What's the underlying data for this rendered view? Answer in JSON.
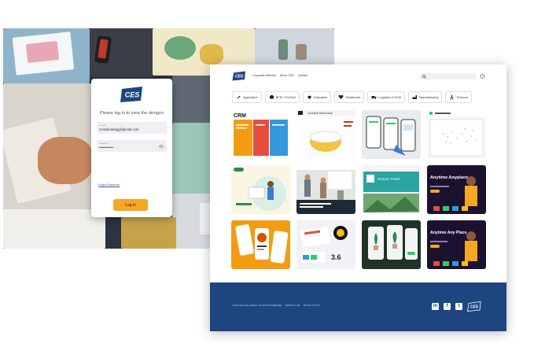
{
  "login": {
    "logo_text": "CES",
    "prompt": "Please log in to view the designs",
    "email_label": "E-mail",
    "email_value": "Cristiandebgg@gmail.com",
    "password_label": "Password",
    "password_value": "••••••••••••",
    "forgot_link": "Forgot Password",
    "login_button": "Log in"
  },
  "portfolio": {
    "logo_text": "CES",
    "nav": [
      "Corporate Website",
      "About CES",
      "Contact"
    ],
    "categories": [
      {
        "label": "Agriculture",
        "icon": "agriculture-icon"
      },
      {
        "label": "BFSI / FinTech",
        "icon": "fintech-icon"
      },
      {
        "label": "Education",
        "icon": "graduation-cap-icon"
      },
      {
        "label": "Healthcare",
        "icon": "heart-icon"
      },
      {
        "label": "Logistics & SCM",
        "icon": "truck-icon"
      },
      {
        "label": "Manufacturing",
        "icon": "factory-icon"
      },
      {
        "label": "Telecom",
        "icon": "tower-icon"
      }
    ],
    "thumbnails": [
      {
        "title": "CRM",
        "caption": "Cohort table app design"
      },
      {
        "title": "Cerebral Teach Now",
        "caption": "Education app"
      },
      {
        "title": "",
        "caption": "Mobile app screens"
      },
      {
        "title": "",
        "caption": "Data dashboard"
      },
      {
        "title": "",
        "caption": "Healthcare web"
      },
      {
        "title": "",
        "caption": "Office team"
      },
      {
        "title": "Genetic Portal",
        "caption": "Genetics app"
      },
      {
        "title": "Anytime Anyplace",
        "caption": "Telecom app"
      },
      {
        "title": "",
        "caption": "Food mobile app"
      },
      {
        "title": "",
        "caption": "3.6 design"
      },
      {
        "title": "",
        "caption": "Plant shop"
      },
      {
        "title": "Anytime Any Place",
        "caption": "Telecom app"
      }
    ],
    "footer": {
      "copyright": "© 2022-2023 CES LIMITED. ALL RIGHTS RESERVED",
      "terms": "TERMS OF USE",
      "privacy": "PRIVACY POLICY",
      "logo_text": "CES"
    }
  },
  "colors": {
    "brand_navy": "#1d4681",
    "accent_orange": "#f5a623"
  }
}
